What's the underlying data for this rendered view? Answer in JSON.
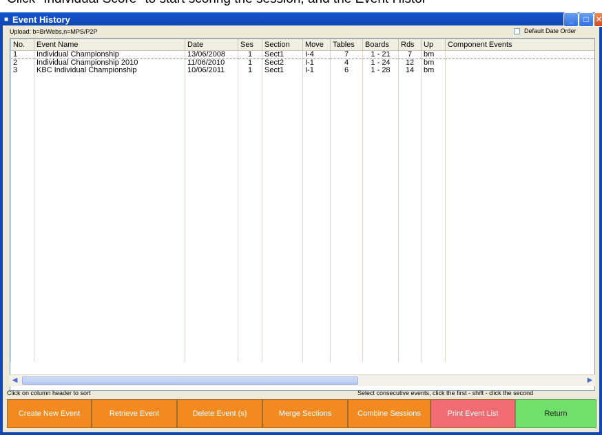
{
  "doc_text": "Click \"Individual Score\" to start scoring the session, and the Event Histor",
  "window": {
    "title": "Event History",
    "icons": {
      "app": "app-icon",
      "minimize": "minimize-icon",
      "maximize": "maximize-icon",
      "close": "close-icon"
    }
  },
  "toolbar": {
    "upload_label": "Upload: b=BrWebs,n=MPS/P2P",
    "default_date_order": "Default Date Order"
  },
  "table": {
    "columns": [
      "No.",
      "Event Name",
      "Date",
      "Ses",
      "Section",
      "Move",
      "Tables",
      "Boards",
      "Rds",
      "Up",
      "Component Events"
    ],
    "rows": [
      {
        "no": "1",
        "name": "Individual Championship",
        "date": "13/06/2008",
        "ses": "1",
        "section": "Sect1",
        "move": "I-4",
        "tables": "7",
        "boards": "1 - 21",
        "rds": "7",
        "up": "bm",
        "components": ""
      },
      {
        "no": "2",
        "name": "Individual Championship 2010",
        "date": "11/06/2010",
        "ses": "1",
        "section": "Sect2",
        "move": "I-1",
        "tables": "4",
        "boards": "1 - 24",
        "rds": "12",
        "up": "bm",
        "components": ""
      },
      {
        "no": "3",
        "name": "KBC Individual Championship",
        "date": "10/06/2011",
        "ses": "1",
        "section": "Sect1",
        "move": "I-1",
        "tables": "6",
        "boards": "1 - 28",
        "rds": "14",
        "up": "bm",
        "components": ""
      }
    ]
  },
  "hints": {
    "left": "Click on column header to sort",
    "right": "Select consecutive events, click the first - shift - click the second"
  },
  "buttons": {
    "create_new_event": "Create New Event",
    "retrieve_event": "Retrieve Event",
    "delete_event": "Delete Event (s)",
    "merge_sections": "Merge Sections",
    "combine_sessions": "Combine Sessions",
    "print_event_list": "Print Event List",
    "return": "Return"
  },
  "colors": {
    "title_bar": "#1553c8",
    "action_orange": "#f28a1f",
    "print_pink": "#f06c72",
    "return_green": "#6fe06a"
  }
}
